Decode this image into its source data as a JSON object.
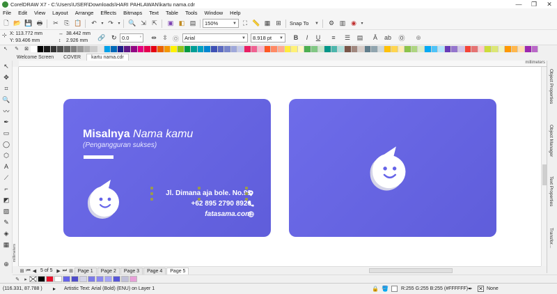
{
  "window": {
    "title": "CorelDRAW X7 - C:\\Users\\USER\\Downloads\\HARI PAHLAWAN\\kartu nama.cdr",
    "minimize": "—",
    "maximize": "❐",
    "close": "✕"
  },
  "menu": [
    "File",
    "Edit",
    "View",
    "Layout",
    "Arrange",
    "Effects",
    "Bitmaps",
    "Text",
    "Table",
    "Tools",
    "Window",
    "Help"
  ],
  "toolbar": {
    "zoom": "150%",
    "snap_to": "Snap To"
  },
  "property_bar": {
    "x": "X: 113.772 mm",
    "y": "Y: 93.406 mm",
    "width": "38.442 mm",
    "height": "2.926 mm",
    "angle": "0.0",
    "font": "Arial",
    "font_size": "8.918 pt"
  },
  "doc_tabs": [
    "Welcome Screen",
    "COVER",
    "kartu nama.cdr"
  ],
  "ruler_unit": "millimeters",
  "right_dock": [
    "Object Properties",
    "Object Manager",
    "Text Properties",
    "Transfor..."
  ],
  "card_front": {
    "name_bold": "Misalnya",
    "name_italic": "Nama kamu",
    "tagline": "(Pengangguran sukses)",
    "address": "Jl. Dimana aja bole. No.99",
    "phone": "+62 895 2790 8926",
    "website": "fatasama.com"
  },
  "page_nav": {
    "counter": "5 of 5",
    "pages": [
      "Page 1",
      "Page 2",
      "Page 3",
      "Page 4",
      "Page 5"
    ],
    "active_page": "Page 5"
  },
  "status": {
    "cursor": "(116.331, 87.788 )",
    "object_info": "Artistic Text: Arial (Bold) (ENU) on Layer 1",
    "fill": "R:255 G:255 B:255 (#FFFFFF)",
    "outline": "None"
  },
  "colors": {
    "card": "#6563e8",
    "card_dark": "#4f4dc9",
    "mascot": "#ffffff",
    "mascot_shadow": "#d4d4e8"
  }
}
